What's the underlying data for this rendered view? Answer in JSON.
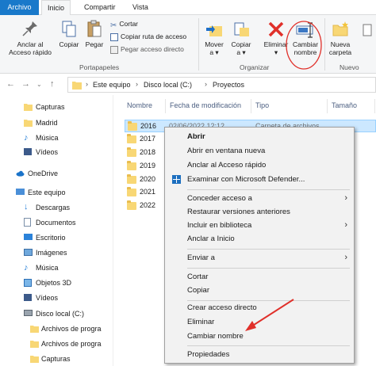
{
  "tabs": {
    "file": "Archivo",
    "home": "Inicio",
    "share": "Compartir",
    "view": "Vista"
  },
  "ribbon": {
    "pin": "Anclar al\nAcceso rápido",
    "copy": "Copiar",
    "paste": "Pegar",
    "cut": "Cortar",
    "copy_path": "Copiar ruta de acceso",
    "paste_shortcut": "Pegar acceso directo",
    "move_to": "Mover\na ▾",
    "copy_to": "Copiar\na ▾",
    "delete": "Eliminar ▾",
    "rename": "Cambiar\nnombre",
    "new_folder": "Nueva\ncarpeta",
    "group_clipboard": "Portapapeles",
    "group_organize": "Organizar",
    "group_new": "Nuevo"
  },
  "address": {
    "crumbs": [
      "Este equipo",
      "Disco local (C:)",
      "Proyectos"
    ]
  },
  "nav": {
    "items": [
      {
        "label": "Capturas",
        "icon": "folder-icon"
      },
      {
        "label": "Madrid",
        "icon": "folder-icon"
      },
      {
        "label": "Música",
        "icon": "music-icon"
      },
      {
        "label": "Vídeos",
        "icon": "video-icon"
      },
      {
        "label": "OneDrive",
        "icon": "cloud-icon"
      },
      {
        "label": "Este equipo",
        "icon": "computer-icon"
      },
      {
        "label": "Descargas",
        "icon": "download-icon"
      },
      {
        "label": "Documentos",
        "icon": "document-icon"
      },
      {
        "label": "Escritorio",
        "icon": "desktop-icon"
      },
      {
        "label": "Imágenes",
        "icon": "image-icon"
      },
      {
        "label": "Música",
        "icon": "music-icon"
      },
      {
        "label": "Objetos 3D",
        "icon": "cube-icon"
      },
      {
        "label": "Vídeos",
        "icon": "video-icon"
      },
      {
        "label": "Disco local (C:)",
        "icon": "drive-icon"
      },
      {
        "label": "Archivos de progra",
        "icon": "folder-icon"
      },
      {
        "label": "Archivos de progra",
        "icon": "folder-icon"
      },
      {
        "label": "Capturas",
        "icon": "folder-icon"
      }
    ]
  },
  "columns": {
    "name": "Nombre",
    "modified": "Fecha de modificación",
    "type": "Tipo",
    "size": "Tamaño"
  },
  "files": [
    {
      "name": "2016",
      "date": "02/06/2022 12:12",
      "type": "Carpeta de archivos"
    },
    {
      "name": "2017"
    },
    {
      "name": "2018"
    },
    {
      "name": "2019"
    },
    {
      "name": "2020"
    },
    {
      "name": "2021"
    },
    {
      "name": "2022"
    }
  ],
  "context_menu": {
    "open": "Abrir",
    "open_new_window": "Abrir en ventana nueva",
    "pin_quick": "Anclar al Acceso rápido",
    "scan_defender": "Examinar con Microsoft Defender...",
    "grant_access": "Conceder acceso a",
    "restore_versions": "Restaurar versiones anteriores",
    "include_library": "Incluir en biblioteca",
    "pin_start": "Anclar a Inicio",
    "send_to": "Enviar a",
    "cut": "Cortar",
    "copy": "Copiar",
    "create_shortcut": "Crear acceso directo",
    "delete": "Eliminar",
    "rename": "Cambiar nombre",
    "properties": "Propiedades"
  },
  "colors": {
    "accent": "#1979ca",
    "selection": "#cce8ff",
    "annotation": "#e0302a",
    "folder": "#f8d775"
  }
}
